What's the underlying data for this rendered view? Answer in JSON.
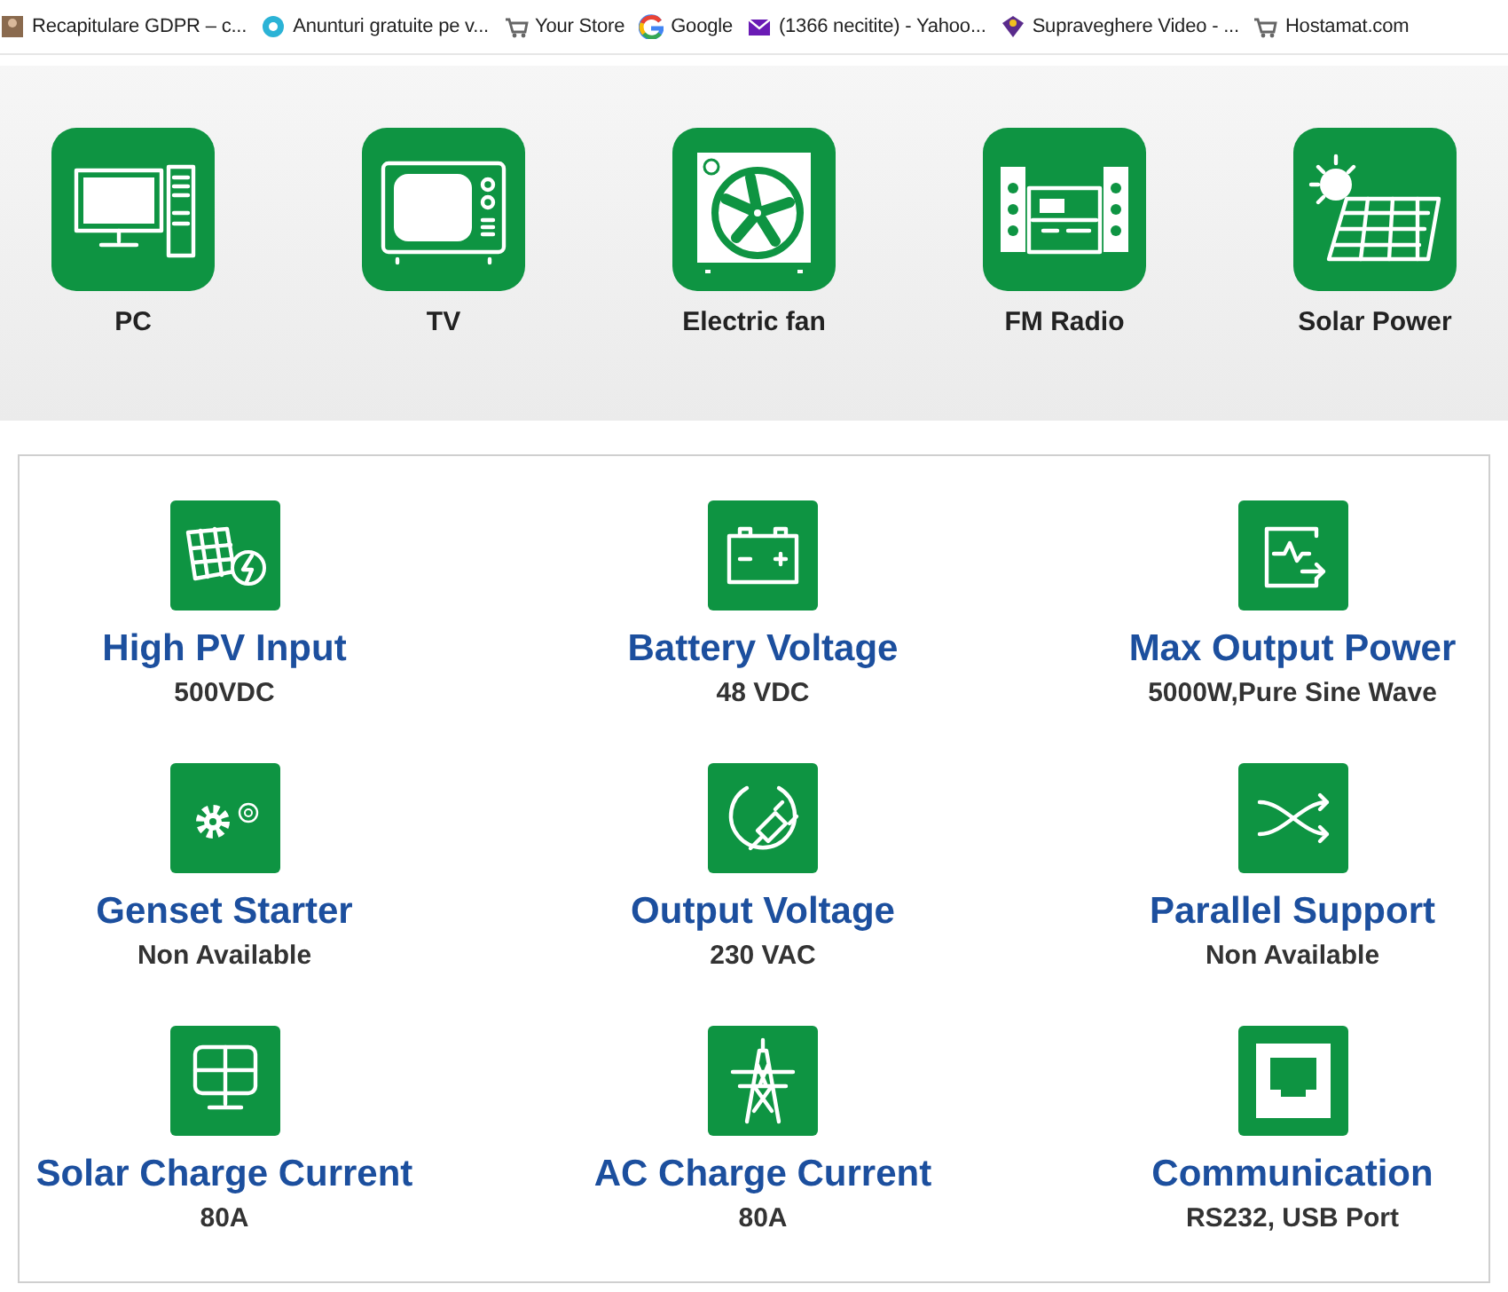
{
  "bookmarks": [
    {
      "label": "Recapitulare GDPR – c...",
      "kind": "thumb"
    },
    {
      "label": "Anunturi gratuite pe v...",
      "kind": "bubble"
    },
    {
      "label": "Your Store",
      "kind": "cart"
    },
    {
      "label": "Google",
      "kind": "ring"
    },
    {
      "label": "(1366 necitite) - Yahoo...",
      "kind": "mail"
    },
    {
      "label": "Supraveghere Video - ...",
      "kind": "shield"
    },
    {
      "label": "Hostamat.com",
      "kind": "cart"
    }
  ],
  "appliances": [
    {
      "label": "PC",
      "kind": "pc"
    },
    {
      "label": "TV",
      "kind": "tv"
    },
    {
      "label": "Electric fan",
      "kind": "fan"
    },
    {
      "label": "FM Radio",
      "kind": "radio"
    },
    {
      "label": "Solar Power",
      "kind": "solar"
    }
  ],
  "specs": [
    {
      "title": "High PV Input",
      "value": "500VDC",
      "kind": "pv"
    },
    {
      "title": "Battery Voltage",
      "value": "48 VDC",
      "kind": "battery"
    },
    {
      "title": "Max Output Power",
      "value": "5000W,Pure Sine Wave",
      "kind": "output"
    },
    {
      "title": "Genset Starter",
      "value": "Non Available",
      "kind": "gears"
    },
    {
      "title": "Output Voltage",
      "value": "230 VAC",
      "kind": "plug"
    },
    {
      "title": "Parallel Support",
      "value": "Non Available",
      "kind": "shuffle"
    },
    {
      "title": "Solar Charge Current",
      "value": "80A",
      "kind": "panel"
    },
    {
      "title": "AC Charge Current",
      "value": "80A",
      "kind": "pylon"
    },
    {
      "title": "Communication",
      "value": "RS232, USB Port",
      "kind": "port"
    }
  ]
}
